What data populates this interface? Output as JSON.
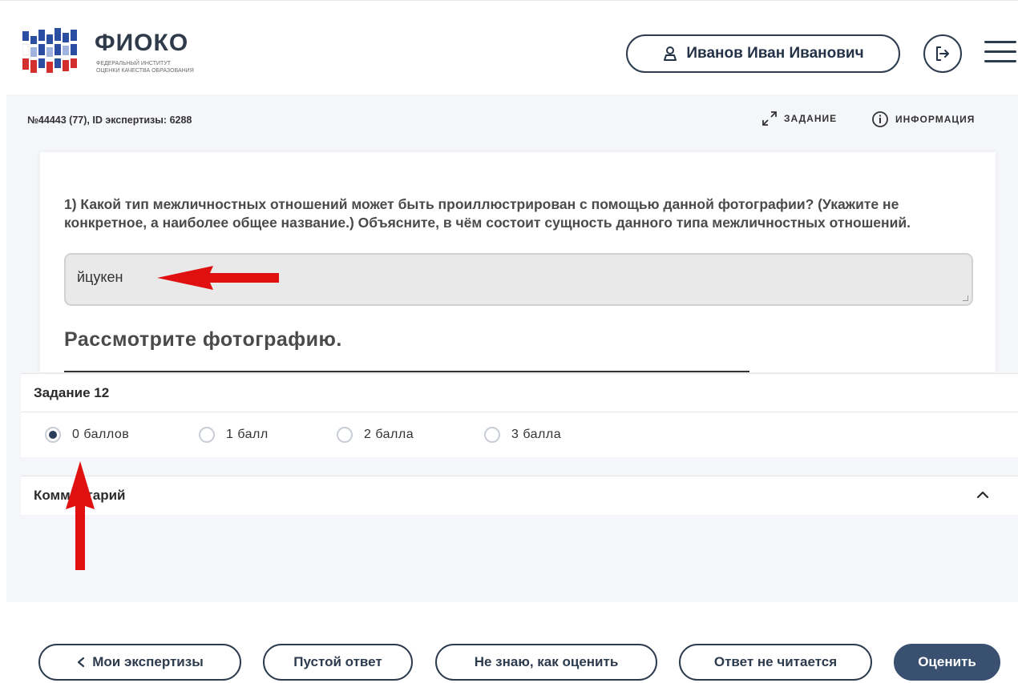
{
  "header": {
    "logo_title": "ФИОКО",
    "logo_sub_line1": "ФЕДЕРАЛЬНЫЙ ИНСТИТУТ",
    "logo_sub_line2": "ОЦЕНКИ КАЧЕСТВА ОБРАЗОВАНИЯ",
    "user_name": "Иванов Иван Иванович",
    "user_icon": "user-icon",
    "logout_icon": "logout-icon",
    "menu_icon": "menu-icon"
  },
  "infobar": {
    "expert_id": "№44443 (77), ID экспертизы: 6288",
    "task_link": "ЗАДАНИЕ",
    "info_link": "ИНФОРМАЦИЯ"
  },
  "task": {
    "question": "1) Какой тип межличностных отношений может быть проиллюстрирован с помощью данной фотографии? (Укажите не конкретное, а наиболее общее название.) Объясните, в чём состоит сущность данного типа межличностных отношений.",
    "answer": "йцукен",
    "photo_title": "Рассмотрите фотографию."
  },
  "scoring": {
    "title": "Задание 12",
    "options": [
      "0 баллов",
      "1 балл",
      "2 балла",
      "3 балла"
    ],
    "selected_index": 0
  },
  "comment": {
    "title": "Комментарий"
  },
  "buttons": {
    "my_expertises": "Мои экспертизы",
    "empty_answer": "Пустой ответ",
    "dont_know": "Не знаю, как оценить",
    "unreadable": "Ответ не читается",
    "evaluate": "Оценить"
  },
  "colors": {
    "primary": "#3a5070",
    "dark": "#2d3b4e",
    "annotation_arrow": "#e01010"
  }
}
